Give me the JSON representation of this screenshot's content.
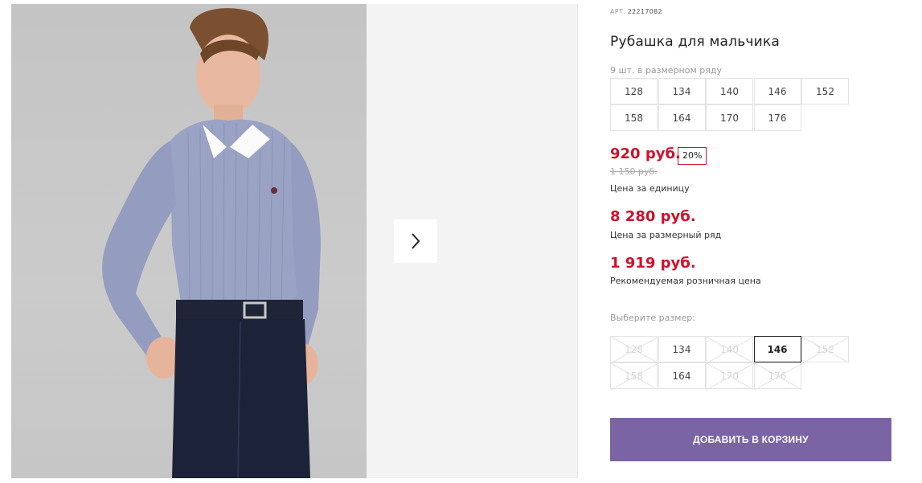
{
  "gallery": {
    "next_icon": "chevron-right-icon"
  },
  "product": {
    "article_label": "АРТ.",
    "article_number": "22217082",
    "title": "Рубашка для мальчика",
    "size_row_label": "9 шт. в размерном ряду",
    "size_row": [
      "128",
      "134",
      "140",
      "146",
      "152",
      "158",
      "164",
      "170",
      "176"
    ],
    "price_unit": "920 руб.",
    "discount": "20%",
    "old_price": "1 150 руб.",
    "price_unit_label": "Цена за единицу",
    "price_row": "8 280 руб.",
    "price_row_label": "Цена за размерный ряд",
    "price_retail": "1 919 руб.",
    "price_retail_label": "Рекомендуемая розничная цена",
    "choose_size_label": "Выберите размер:",
    "size_options": [
      {
        "label": "128",
        "available": false
      },
      {
        "label": "134",
        "available": true
      },
      {
        "label": "140",
        "available": false
      },
      {
        "label": "146",
        "available": true,
        "selected": true
      },
      {
        "label": "152",
        "available": false
      },
      {
        "label": "158",
        "available": false
      },
      {
        "label": "164",
        "available": true
      },
      {
        "label": "170",
        "available": false
      },
      {
        "label": "176",
        "available": false
      }
    ],
    "add_to_cart": "ДОБАВИТЬ В КОРЗИНУ"
  },
  "colors": {
    "price": "#d0102b",
    "button": "#7b64a4",
    "selected_border": "#222222"
  }
}
